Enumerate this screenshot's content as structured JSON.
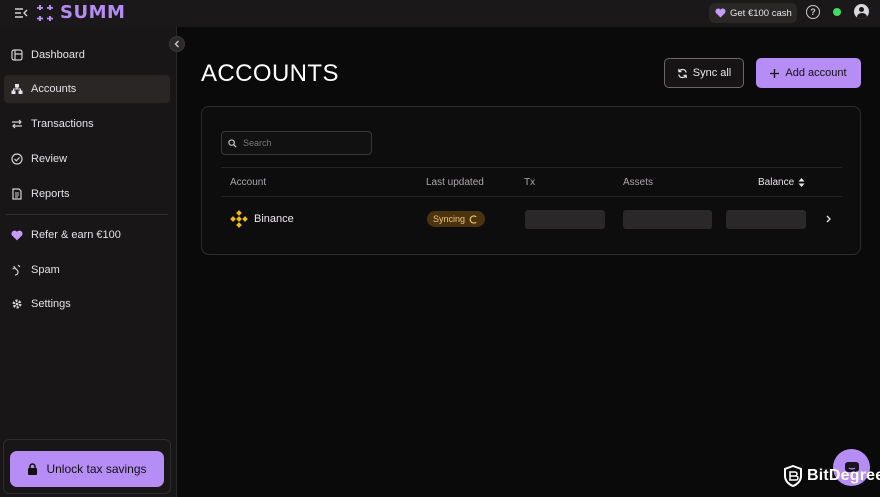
{
  "app": {
    "brand": "SUMM"
  },
  "topbar": {
    "promo_label": "Get €100 cash"
  },
  "sidebar": {
    "items": [
      {
        "label": "Dashboard",
        "icon": "dashboard-icon"
      },
      {
        "label": "Accounts",
        "icon": "accounts-icon",
        "active": true
      },
      {
        "label": "Transactions",
        "icon": "transactions-icon"
      },
      {
        "label": "Review",
        "icon": "review-icon"
      },
      {
        "label": "Reports",
        "icon": "reports-icon"
      },
      {
        "label": "Refer & earn €100",
        "icon": "heart-icon"
      },
      {
        "label": "Spam",
        "icon": "spam-icon"
      },
      {
        "label": "Settings",
        "icon": "gear-icon"
      }
    ],
    "unlock_label": "Unlock tax savings"
  },
  "main": {
    "title": "ACCOUNTS",
    "sync_label": "Sync all",
    "add_label": "Add account",
    "search_placeholder": "Search",
    "columns": [
      "Account",
      "Last updated",
      "Tx",
      "Assets",
      "Balance"
    ],
    "rows": [
      {
        "account": "Binance",
        "status": "Syncing"
      }
    ]
  },
  "watermark": {
    "text": "BitDegree"
  },
  "colors": {
    "accent": "#b68cf5",
    "background": "#0b0a0a",
    "sidebar": "#181616",
    "syncing_text": "#f2c46a",
    "syncing_bg": "#4a3410",
    "status_online": "#3ddc64",
    "binance": "#f0b90b"
  }
}
